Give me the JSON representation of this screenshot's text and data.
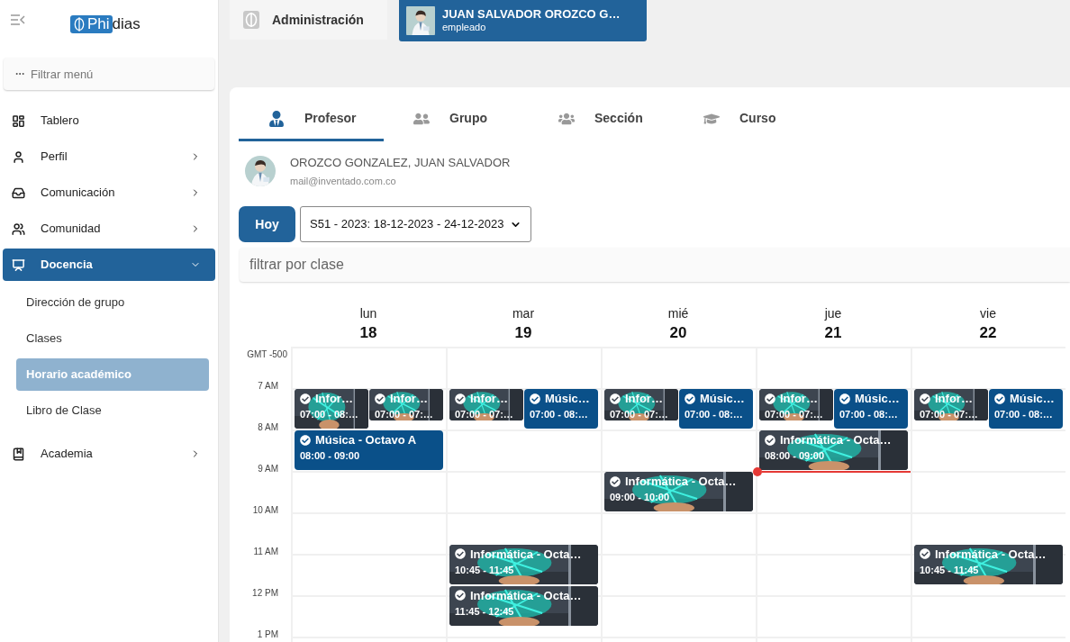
{
  "logo": {
    "boxed": "Phi",
    "rest": "dias"
  },
  "menu_filter": {
    "placeholder": "Filtrar menú"
  },
  "sidebar": {
    "items": [
      {
        "label": "Tablero",
        "selected": false
      },
      {
        "label": "Perfil",
        "selected": false,
        "expanded": false
      },
      {
        "label": "Comunicación",
        "selected": false,
        "expanded": false
      },
      {
        "label": "Comunidad",
        "selected": false,
        "expanded": false
      },
      {
        "label": "Docencia",
        "selected": true,
        "expanded": true,
        "children": [
          {
            "label": "Dirección de grupo",
            "selected": false
          },
          {
            "label": "Clases",
            "selected": false
          },
          {
            "label": "Horario académico",
            "selected": true
          },
          {
            "label": "Libro de Clase",
            "selected": false
          }
        ]
      },
      {
        "label": "Academia",
        "selected": false,
        "expanded": false
      }
    ]
  },
  "top_bar": {
    "module": "Administración",
    "user": {
      "name": "JUAN SALVADOR OROZCO G…",
      "role": "empleado"
    }
  },
  "tabs": [
    {
      "label": "Profesor",
      "selected": true
    },
    {
      "label": "Grupo",
      "selected": false
    },
    {
      "label": "Sección",
      "selected": false
    },
    {
      "label": "Curso",
      "selected": false
    }
  ],
  "teacher": {
    "name": "OROZCO GONZALEZ, JUAN SALVADOR",
    "email": "mail@inventado.com.co"
  },
  "today_button": "Hoy",
  "week_select": {
    "value": "S51 - 2023: 18-12-2023 - 24-12-2023"
  },
  "class_filter": {
    "placeholder": "filtrar por clase"
  },
  "time_labels": [
    "GMT -500",
    "7 AM",
    "8 AM",
    "9 AM",
    "10 AM",
    "11 AM",
    "12 PM",
    "1 PM"
  ],
  "days": [
    {
      "name": "lun",
      "date": "18",
      "today": false,
      "events": [
        {
          "overlapped": true,
          "title": "Infor…",
          "time": "07:00 - 08:…"
        },
        {
          "overlapped": true,
          "title": "Infor…",
          "time": "07:00 - 07:…"
        },
        {
          "kind": "solid",
          "overlapped": false,
          "title": "Música - Octavo A",
          "time": "08:00 - 09:00"
        }
      ]
    },
    {
      "name": "mar",
      "date": "19",
      "today": false,
      "events": [
        {
          "overlapped": true,
          "title": "Infor…",
          "time": "07:00 - 07:…"
        },
        {
          "kind": "solid",
          "overlapped": true,
          "title": "Músic…",
          "time": "07:00 - 08:…"
        },
        {
          "overlapped": false,
          "title": "Informática - Octa…",
          "time": "10:45 - 11:45"
        },
        {
          "overlapped": false,
          "title": "Informática - Octa…",
          "time": "11:45 - 12:45"
        }
      ]
    },
    {
      "name": "mié",
      "date": "20",
      "today": false,
      "events": [
        {
          "overlapped": true,
          "title": "Infor…",
          "time": "07:00 - 07:…"
        },
        {
          "kind": "solid",
          "overlapped": true,
          "title": "Músic…",
          "time": "07:00 - 08:…"
        },
        {
          "overlapped": false,
          "title": "Informática - Octa…",
          "time": "09:00 - 10:00"
        }
      ]
    },
    {
      "name": "jue",
      "date": "21",
      "today": true,
      "events": [
        {
          "overlapped": true,
          "title": "Infor…",
          "time": "07:00 - 07:…"
        },
        {
          "kind": "solid",
          "overlapped": true,
          "title": "Músic…",
          "time": "07:00 - 08:…"
        },
        {
          "overlapped": false,
          "title": "Informática - Octa…",
          "time": "08:00 - 09:00"
        }
      ]
    },
    {
      "name": "vie",
      "date": "22",
      "today": false,
      "events": [
        {
          "overlapped": true,
          "title": "Infor…",
          "time": "07:00 - 07:…"
        },
        {
          "kind": "solid",
          "overlapped": true,
          "title": "Músic…",
          "time": "07:00 - 08:…"
        },
        {
          "overlapped": false,
          "title": "Informática - Octa…",
          "time": "10:45 - 11:45"
        }
      ]
    }
  ]
}
